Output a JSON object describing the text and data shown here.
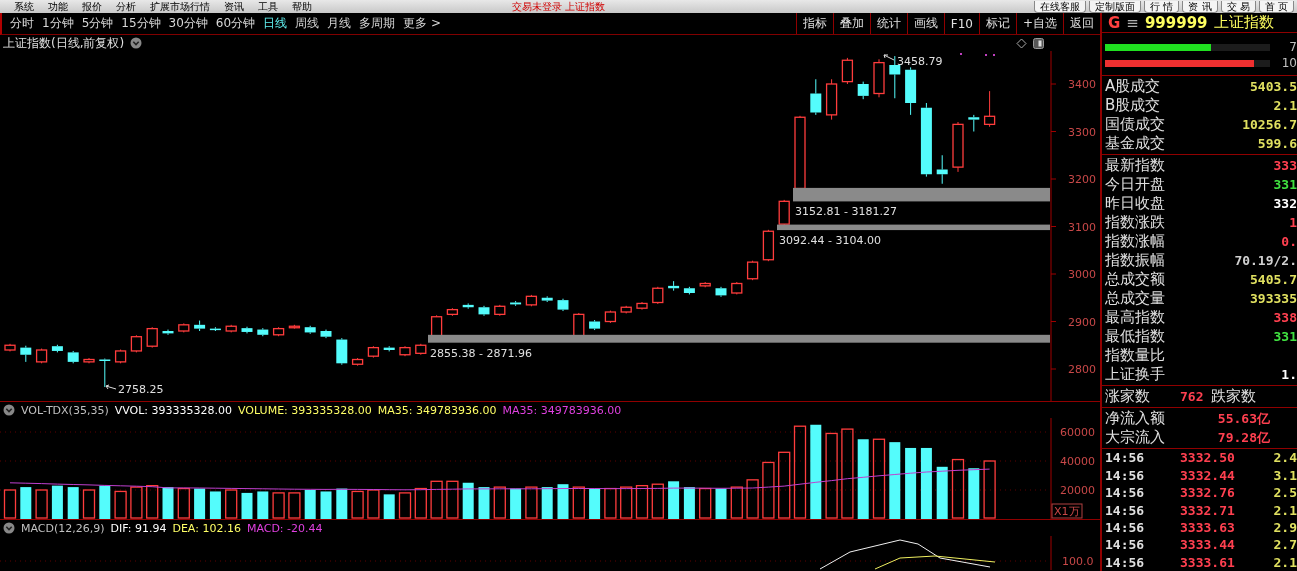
{
  "menu_bar": {
    "items": [
      "系统",
      "功能",
      "报价",
      "分析",
      "扩展市场行情",
      "资讯",
      "工具",
      "帮助"
    ],
    "title": "交易未登录 上证指数",
    "buttons": [
      "在线客服",
      "定制版面",
      "行 情",
      "资 讯",
      "交 易",
      "首 页"
    ]
  },
  "period_tabs": [
    {
      "label": "分时",
      "selected": false
    },
    {
      "label": "1分钟",
      "selected": false
    },
    {
      "label": "5分钟",
      "selected": false
    },
    {
      "label": "15分钟",
      "selected": false
    },
    {
      "label": "30分钟",
      "selected": false
    },
    {
      "label": "60分钟",
      "selected": false
    },
    {
      "label": "日线",
      "selected": true
    },
    {
      "label": "周线",
      "selected": false
    },
    {
      "label": "月线",
      "selected": false
    },
    {
      "label": "多周期",
      "selected": false
    },
    {
      "label": "更多 >",
      "selected": false
    }
  ],
  "chart_buttons": [
    "指标",
    "叠加",
    "统计",
    "画线",
    "F10",
    "标记",
    "+自选",
    "返回"
  ],
  "price_pane": {
    "title": "上证指数(日线,前复权)",
    "axis_labels": [
      "3400",
      "3300",
      "3200",
      "3100",
      "3000",
      "2900",
      "2800"
    ],
    "annotations": [
      {
        "kind": "high",
        "text": "3458.79"
      },
      {
        "kind": "low",
        "text": "2758.25"
      }
    ],
    "support_bands": [
      {
        "label": "3152.81 - 3181.27"
      },
      {
        "label": "3092.44 - 3104.00"
      },
      {
        "label": "2855.38 - 2871.96"
      }
    ]
  },
  "volume_pane": {
    "legend": [
      {
        "text": "VOL-TDX(35,35)",
        "color": "#c0c0c0"
      },
      {
        "text": "VVOL: 393335328.00",
        "color": "#ffffff"
      },
      {
        "text": "VOLUME: 393335328.00",
        "color": "#ffff66"
      },
      {
        "text": "MA35: 349783936.00",
        "color": "#ffff66"
      },
      {
        "text": "MA35: 349783936.00",
        "color": "#e040e0"
      }
    ],
    "axis_labels": [
      "60000",
      "40000",
      "20000"
    ],
    "unit": "X1万"
  },
  "macd_pane": {
    "legend": [
      {
        "text": "MACD(12,26,9)",
        "color": "#c0c0c0"
      },
      {
        "text": "DIF: 91.94",
        "color": "#ffffff"
      },
      {
        "text": "DEA: 102.16",
        "color": "#ffff66"
      },
      {
        "text": "MACD: -20.44",
        "color": "#e040e0"
      }
    ],
    "axis_labels": [
      "100.0"
    ]
  },
  "quote_panel": {
    "header": {
      "mark": "G",
      "menu": "≡",
      "code": "999999",
      "name": "上证指数"
    },
    "breadth_bars": [
      {
        "kind": "down",
        "count": "7",
        "level": 0.64
      },
      {
        "kind": "up",
        "count": "10",
        "level": 0.9
      }
    ],
    "groups": [
      [
        {
          "label": "A股成交",
          "value": "5403.5",
          "color": "#e0e060"
        },
        {
          "label": "B股成交",
          "value": "2.1",
          "color": "#e0e060"
        },
        {
          "label": "国债成交",
          "value": "10256.7",
          "color": "#e0e060"
        },
        {
          "label": "基金成交",
          "value": "599.6",
          "color": "#e0e060"
        }
      ],
      [
        {
          "label": "最新指数",
          "value": "333",
          "color": "#ff4050"
        },
        {
          "label": "今日开盘",
          "value": "331",
          "color": "#40e040"
        },
        {
          "label": "昨日收盘",
          "value": "332",
          "color": "#ffffff"
        },
        {
          "label": "指数涨跌",
          "value": "1",
          "color": "#ff4050"
        },
        {
          "label": "指数涨幅",
          "value": "0.",
          "color": "#ff4050"
        },
        {
          "label": "指数振幅",
          "value": "70.19/2.",
          "color": "#d0d0d0"
        },
        {
          "label": "总成交额",
          "value": "5405.7",
          "color": "#e0e060"
        },
        {
          "label": "总成交量",
          "value": "393335",
          "color": "#e0e060"
        },
        {
          "label": "最高指数",
          "value": "338",
          "color": "#ff4050"
        },
        {
          "label": "最低指数",
          "value": "331",
          "color": "#40e040"
        },
        {
          "label": "指数量比"
        },
        {
          "label": "上证换手",
          "value": "1.",
          "color": "#ffffff"
        }
      ]
    ],
    "advance_decline": {
      "up_label": "涨家数",
      "up_count": "762",
      "down_label": "跌家数"
    },
    "flows": [
      {
        "label": "净流入额",
        "value": "55.63亿"
      },
      {
        "label": "大宗流入",
        "value": "79.28亿"
      }
    ],
    "ticks": [
      {
        "time": "14:56",
        "price": "3332.50",
        "volume": "2.4"
      },
      {
        "time": "14:56",
        "price": "3332.44",
        "volume": "3.1"
      },
      {
        "time": "14:56",
        "price": "3332.76",
        "volume": "2.5"
      },
      {
        "time": "14:56",
        "price": "3332.71",
        "volume": "2.1"
      },
      {
        "time": "14:56",
        "price": "3333.63",
        "volume": "2.9"
      },
      {
        "time": "14:56",
        "price": "3333.44",
        "volume": "2.7"
      },
      {
        "time": "14:56",
        "price": "3333.61",
        "volume": "2.1"
      }
    ]
  }
}
